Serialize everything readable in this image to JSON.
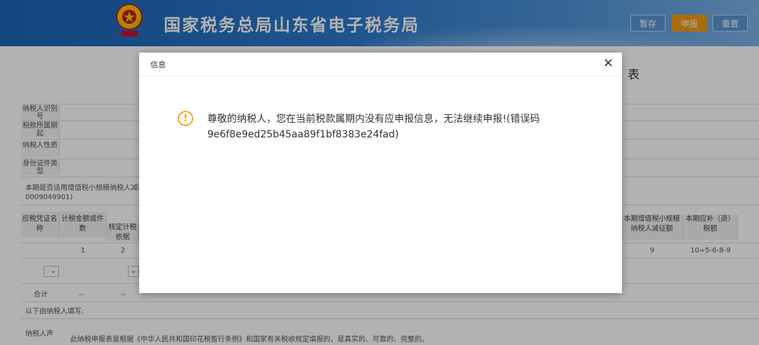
{
  "header": {
    "title": "国家税务总局山东省电子税务局",
    "buttons": {
      "save": "暂存",
      "submit": "申报",
      "reset": "重置"
    },
    "brand_color": "#2b78cc"
  },
  "form": {
    "title_fragment": "表",
    "info_labels": [
      "纳税人识别号",
      "税款所属期起",
      "纳税人性质",
      "身份证件类型"
    ],
    "question_text": "本期是否适用增值税小规模纳税人减征",
    "question_code": "0009049901)",
    "table": {
      "col_headers": {
        "c0": "应税凭证名称",
        "c1": "计税金额或件数",
        "c2": "核定计税依据",
        "c_right1": "本期增值税小规模纳税人减征额",
        "c_right2": "本期应补（退）税额"
      },
      "numbers": {
        "n1": "1",
        "n2": "2",
        "n9": "9",
        "n10": "10=5-6-8-9"
      },
      "total_label": "合计",
      "total_values": [
        "--",
        "--"
      ]
    },
    "below_label": "以下由纳税人填写:",
    "declarant_label": "纳税人声",
    "declaration_text": "此纳税申报表是根据《中华人民共和国印花税暂行条例》和国家有关税收规定填报的，是真实的、可靠的、完整的。"
  },
  "dialog": {
    "title": "信息",
    "close_symbol": "×",
    "icon": "warning-icon",
    "icon_symbol": "!",
    "message": "尊敬的纳税人，您在当前税款属期内没有应申报信息，无法继续申报!(错误码9e6f8e9ed25b45aa89f1bf8383e24fad)",
    "accent_color": "#f5a623"
  }
}
